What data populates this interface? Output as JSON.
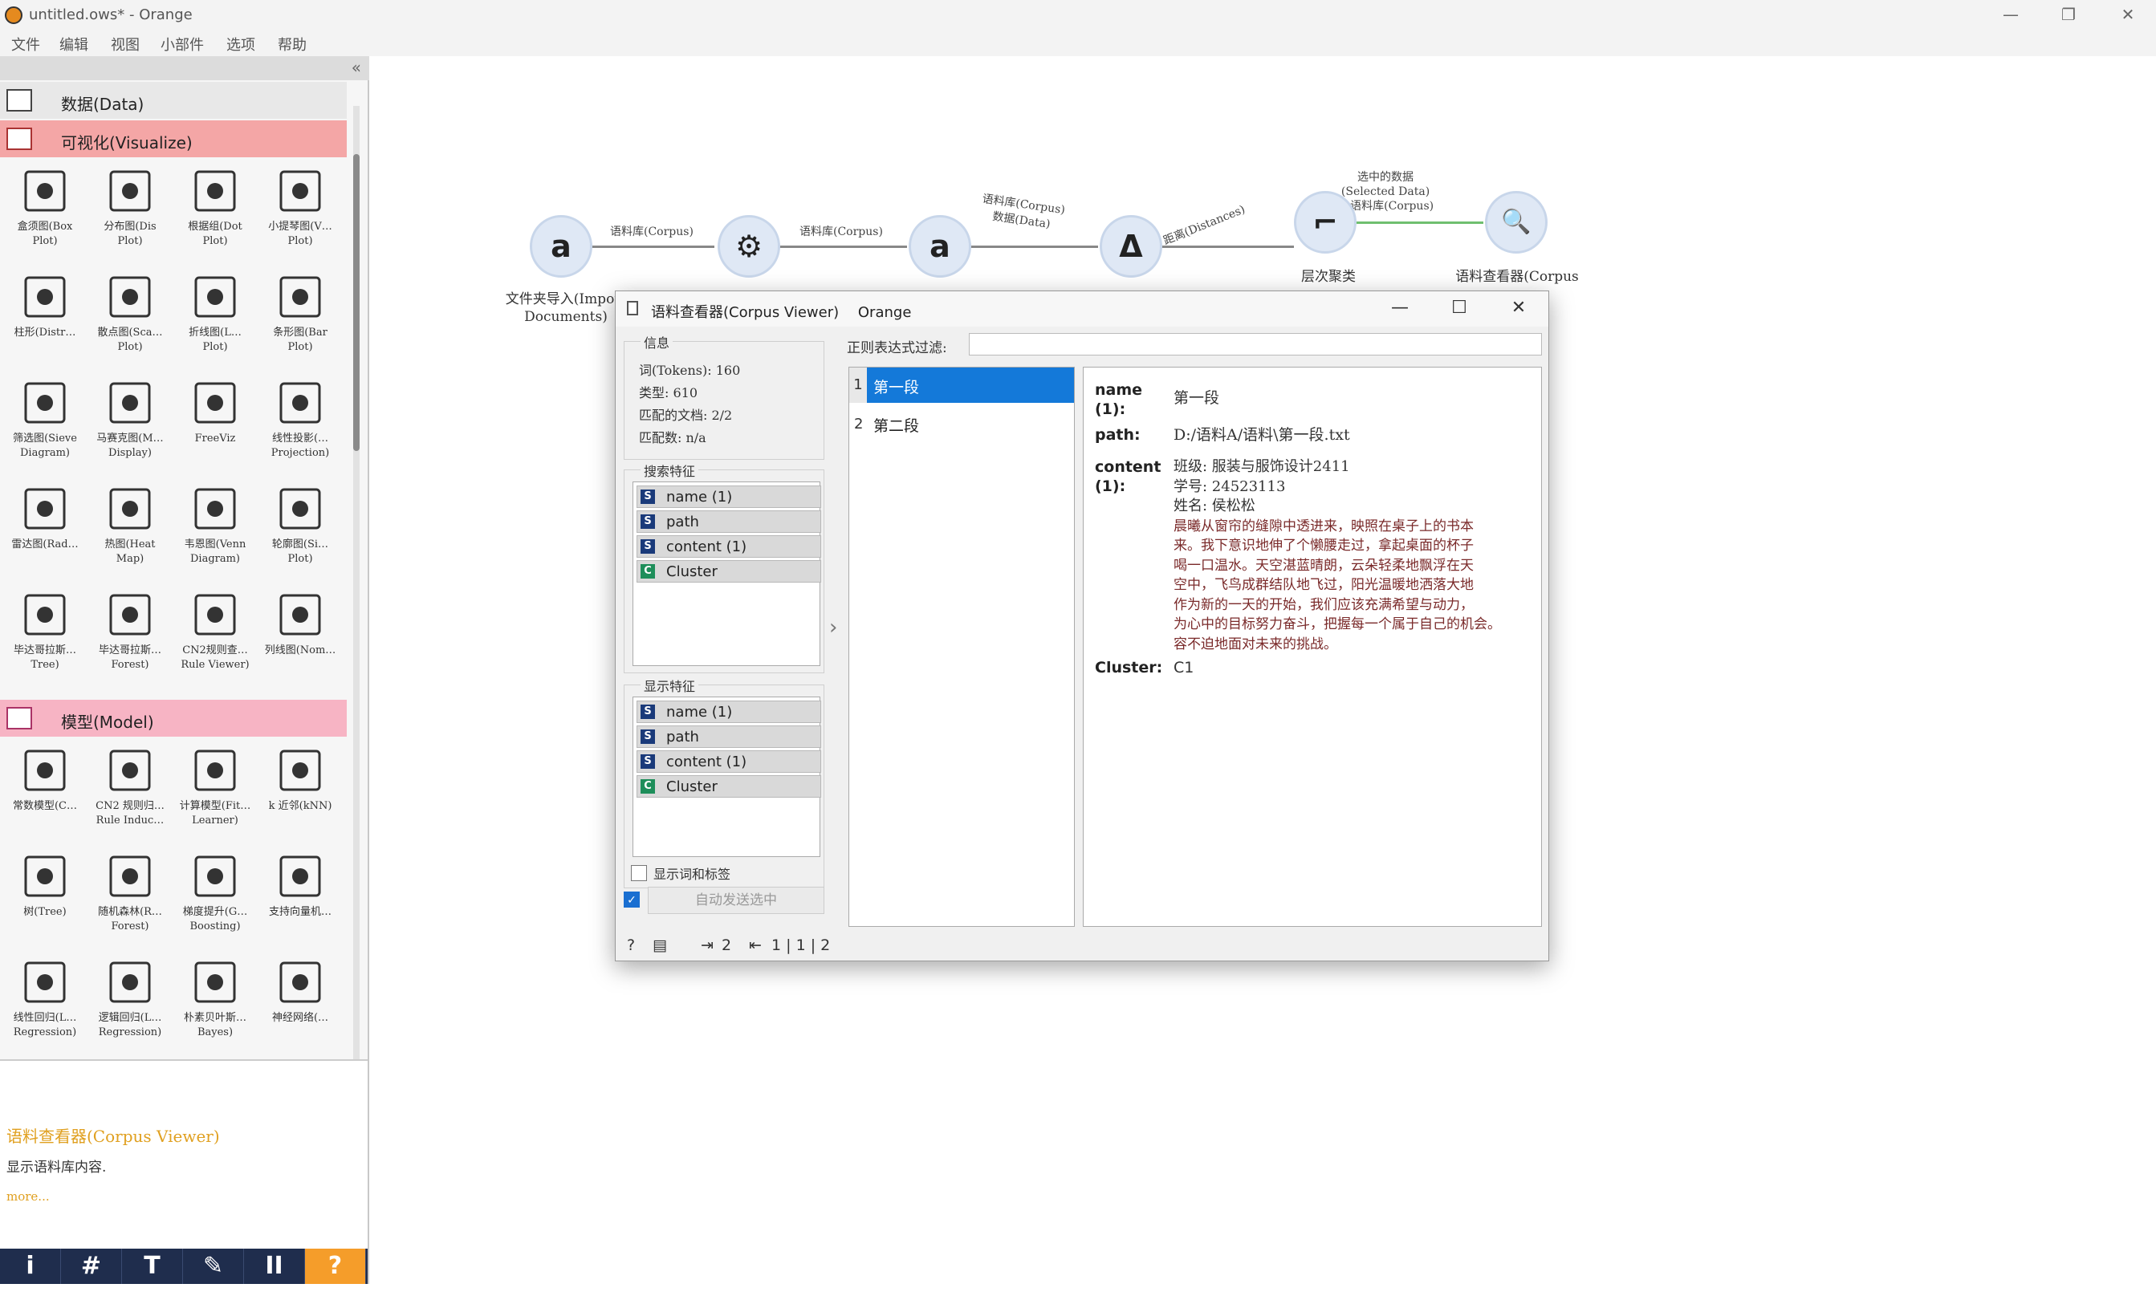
{
  "window": {
    "title": "untitled.ows* - Orange",
    "controls": [
      "—",
      "❐",
      "✕"
    ]
  },
  "menu": [
    "文件",
    "编辑",
    "视图",
    "小部件",
    "选项",
    "帮助"
  ],
  "dock": {
    "collapse_glyph": "«",
    "categories": {
      "data": {
        "label": "数据(Data)"
      },
      "visualize": {
        "label": "可视化(Visualize)"
      },
      "model": {
        "label": "模型(Model)"
      }
    },
    "visualize_widgets": [
      {
        "label": "盒须图(Box\nPlot)",
        "icon": "box-plot-icon"
      },
      {
        "label": "分布图(Dis\nPlot)",
        "icon": "distributions-icon"
      },
      {
        "label": "根据组(Dot\nPlot)",
        "icon": "bar-plot-icon"
      },
      {
        "label": "小提琴图(V…\nPlot)",
        "icon": "violin-plot-icon"
      },
      {
        "label": "柱形(Distr…",
        "icon": "bar-chart-icon"
      },
      {
        "label": "散点图(Sca…\nPlot)",
        "icon": "scatter-plot-icon"
      },
      {
        "label": "折线图(L…\nPlot)",
        "icon": "line-plot-icon"
      },
      {
        "label": "条形图(Bar\nPlot)",
        "icon": "bar-plot-2-icon"
      },
      {
        "label": "筛选图(Sieve\nDiagram)",
        "icon": "sieve-diagram-icon"
      },
      {
        "label": "马赛克图(M…\nDisplay)",
        "icon": "mosaic-icon"
      },
      {
        "label": "FreeViz",
        "icon": "freeviz-icon"
      },
      {
        "label": "线性投影(…\nProjection)",
        "icon": "linear-projection-icon"
      },
      {
        "label": "雷达图(Rad…",
        "icon": "radviz-icon"
      },
      {
        "label": "热图(Heat\nMap)",
        "icon": "heat-map-icon"
      },
      {
        "label": "韦恩图(Venn\nDiagram)",
        "icon": "venn-diagram-icon"
      },
      {
        "label": "轮廓图(Si…\nPlot)",
        "icon": "silhouette-icon"
      },
      {
        "label": "毕达哥拉斯…\nTree)",
        "icon": "pythagorean-tree-icon"
      },
      {
        "label": "毕达哥拉斯…\nForest)",
        "icon": "pythagorean-forest-icon"
      },
      {
        "label": "CN2规则查…\nRule Viewer)",
        "icon": "rule-viewer-icon"
      },
      {
        "label": "列线图(Nom…",
        "icon": "nomogram-icon"
      }
    ],
    "model_widgets": [
      {
        "label": "常数模型(C…",
        "icon": "constant-icon"
      },
      {
        "label": "CN2 规则归…\nRule Induc…",
        "icon": "cn2-icon"
      },
      {
        "label": "计算模型(Fit…\nLearner)",
        "icon": "calibrated-icon"
      },
      {
        "label": "k 近邻(kNN)",
        "icon": "knn-icon"
      },
      {
        "label": "树(Tree)",
        "icon": "tree-icon"
      },
      {
        "label": "随机森林(R…\nForest)",
        "icon": "random-forest-icon"
      },
      {
        "label": "梯度提升(G…\nBoosting)",
        "icon": "gradient-boosting-icon"
      },
      {
        "label": "支持向量机…",
        "icon": "svm-icon"
      },
      {
        "label": "线性回归(L…\nRegression)",
        "icon": "linear-regression-icon"
      },
      {
        "label": "逻辑回归(L…\nRegression)",
        "icon": "logistic-regression-icon"
      },
      {
        "label": "朴素贝叶斯…\nBayes)",
        "icon": "naive-bayes-icon"
      },
      {
        "label": "神经网络(…",
        "icon": "neural-network-icon"
      }
    ],
    "help": {
      "title": "语料查看器(Corpus Viewer)",
      "description": "显示语料库内容.",
      "more": "more..."
    },
    "toolbar": [
      "i",
      "#",
      "T",
      "✎",
      "II",
      "?"
    ]
  },
  "canvas": {
    "nodes": [
      {
        "label": "文件夹导入(Import\nDocuments)",
        "glyph": "a"
      },
      {
        "label": "",
        "glyph": "⚙"
      },
      {
        "label": "",
        "glyph": "a"
      },
      {
        "label": "",
        "glyph": "Δ"
      },
      {
        "label": "层次聚类",
        "glyph": "⌐"
      },
      {
        "label": "语料查看器(Corpus",
        "glyph": "🔍"
      }
    ],
    "edges": [
      {
        "label": "语料库(Corpus)"
      },
      {
        "label": "语料库(Corpus)"
      },
      {
        "label": "语料库(Corpus)\n数据(Data)"
      },
      {
        "label": "距离(Distances)"
      },
      {
        "label": "选中的数据\n(Selected Data)\n→ 语料库(Corpus)"
      }
    ]
  },
  "dialog": {
    "title": "语料查看器(Corpus Viewer)",
    "app": "Orange",
    "controls": [
      "—",
      "☐",
      "✕"
    ],
    "info": {
      "title": "信息",
      "lines": [
        "词(Tokens): 160",
        "类型: 610",
        "匹配的文档: 2/2",
        "匹配数: n/a"
      ]
    },
    "search_features": {
      "title": "搜索特征",
      "items": [
        {
          "name": "name (1)",
          "type": "S"
        },
        {
          "name": "path",
          "type": "S"
        },
        {
          "name": "content (1)",
          "type": "S"
        },
        {
          "name": "Cluster",
          "type": "C"
        }
      ]
    },
    "display_features": {
      "title": "显示特征",
      "items": [
        {
          "name": "name (1)",
          "type": "S"
        },
        {
          "name": "path",
          "type": "S"
        },
        {
          "name": "content (1)",
          "type": "S"
        },
        {
          "name": "Cluster",
          "type": "C"
        }
      ]
    },
    "show_tokens_label": "显示词和标签",
    "send_button": "自动发送选中",
    "filter_label": "正则表达式过滤:",
    "filter_value": "",
    "documents": [
      {
        "index": "1",
        "title": "第一段",
        "selected": true
      },
      {
        "index": "2",
        "title": "第二段",
        "selected": false
      }
    ],
    "document_view": {
      "name_key": "name\n(1):",
      "name_value": "第一段",
      "path_key": "path:",
      "path_value": "D:/语料A/语料\\第一段.txt",
      "content_key": "content\n(1):",
      "content_lines": [
        "班级: 服装与服饰设计2411",
        "学号: 24523113",
        "姓名: 侯松松"
      ],
      "content_story": [
        "晨曦从窗帘的缝隙中透进来，映照在桌子上的书本",
        "来。我下意识地伸了个懒腰走过，拿起桌面的杯子",
        "喝一口温水。天空湛蓝晴朗，云朵轻柔地飘浮在天",
        "空中，飞鸟成群结队地飞过，阳光温暖地洒落大地",
        "作为新的一天的开始，我们应该充满希望与动力，",
        "为心中的目标努力奋斗，把握每一个属于自己的机会。",
        "容不迫地面对未来的挑战。"
      ],
      "cluster_key": "Cluster:",
      "cluster_value": "C1"
    },
    "status": {
      "input_count": "2",
      "output_counts": "1 | 1 | 2"
    }
  }
}
